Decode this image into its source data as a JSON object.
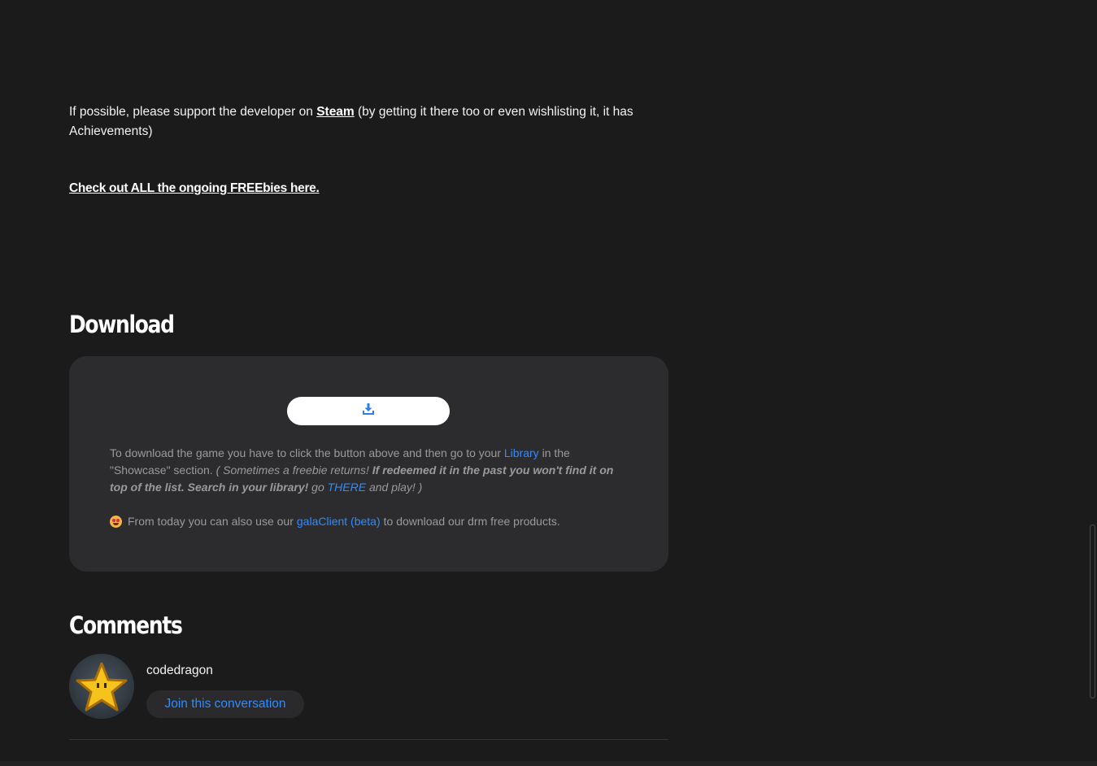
{
  "support": {
    "before": "If possible, please support the developer on ",
    "steam_link": "Steam",
    "after": " (by getting it there too or even wishlisting it, it has Achievements)"
  },
  "freebies_link": "Check out ALL the ongoing FREEbies here.",
  "download": {
    "heading": "Download",
    "button_icon": "download-icon",
    "info_part1": "To download the game you have to click the button above and then go to your ",
    "library_link": "Library",
    "info_part2": " in the \"Showcase\" section. ",
    "italic_part1": "( Sometimes a freebie returns! ",
    "italic_bold": "If redeemed it in the past you won't find it on top of the list. Search in your library!",
    "italic_part2": " go ",
    "there_link": "THERE",
    "italic_part3": " and play! )",
    "client_before": "From today you can also use our",
    "client_link": "galaClient (beta)",
    "client_after": "to download our drm free products.",
    "emoji_icon": "star-struck-emoji-icon"
  },
  "comments": {
    "heading": "Comments",
    "username": "codedragon",
    "avatar_icon": "star-avatar-icon",
    "join_label": "Join this conversation"
  },
  "colors": {
    "background": "#1b1b1c",
    "panel": "#2c2c2e",
    "link_blue": "#2f8cff",
    "muted_text": "#9a9a9e"
  }
}
